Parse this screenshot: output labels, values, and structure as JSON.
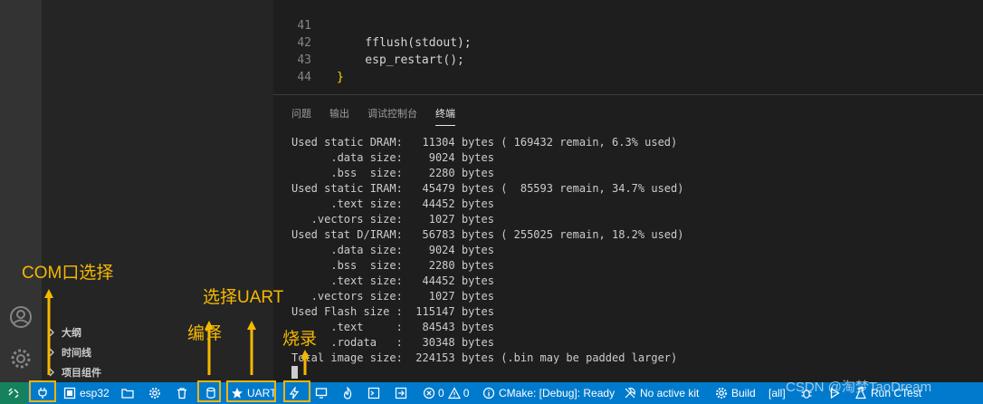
{
  "editor": {
    "lines": [
      {
        "n": "41",
        "code": "    fflush(stdout);"
      },
      {
        "n": "42",
        "code": "    esp_restart();"
      },
      {
        "n": "43",
        "code": "}"
      },
      {
        "n": "44",
        "code": ""
      }
    ]
  },
  "panel": {
    "tabs": [
      "问题",
      "输出",
      "调试控制台",
      "终端"
    ],
    "active_tab": "终端",
    "terminal_lines": [
      "Used static DRAM:   11304 bytes ( 169432 remain, 6.3% used)",
      "      .data size:    9024 bytes",
      "      .bss  size:    2280 bytes",
      "Used static IRAM:   45479 bytes (  85593 remain, 34.7% used)",
      "      .text size:   44452 bytes",
      "   .vectors size:    1027 bytes",
      "Used stat D/IRAM:   56783 bytes ( 255025 remain, 18.2% used)",
      "      .data size:    9024 bytes",
      "      .bss  size:    2280 bytes",
      "      .text size:   44452 bytes",
      "   .vectors size:    1027 bytes",
      "Used Flash size :  115147 bytes",
      "      .text     :   84543 bytes",
      "      .rodata   :   30348 bytes",
      "Total image size:  224153 bytes (.bin may be padded larger)"
    ]
  },
  "sidebar": {
    "sections": [
      "大纲",
      "时间线",
      "项目组件"
    ]
  },
  "statusbar": {
    "target": "esp32",
    "uart": "UART",
    "problems_errors": "0",
    "problems_warnings": "0",
    "cmake": "CMake: [Debug]: Ready",
    "kit": "No active kit",
    "build": "Build",
    "build_target": "[all]",
    "run_ctest": "Run CTest"
  },
  "annotations": {
    "com": "COM口选择",
    "uart": "选择UART",
    "compile": "编译",
    "flash": "烧录"
  },
  "watermark": "CSDN @淘梦TaoDream",
  "colors": {
    "statusbar": "#007acc",
    "highlight": "#f0b400",
    "annotation": "#f5b800"
  }
}
